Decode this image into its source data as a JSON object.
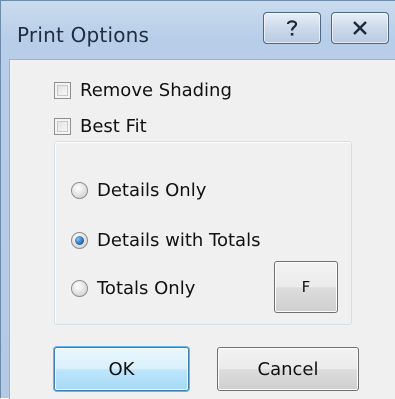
{
  "window": {
    "title": "Print Options",
    "help_label": "?",
    "close_icon": "close-icon"
  },
  "options": {
    "remove_shading": {
      "label": "Remove Shading",
      "checked": false
    },
    "best_fit": {
      "label": "Best Fit",
      "checked": false
    }
  },
  "detail_mode": {
    "selected": "Details with Totals",
    "choices": [
      {
        "label": "Details Only",
        "checked": false
      },
      {
        "label": "Details with Totals",
        "checked": true
      },
      {
        "label": "Totals Only",
        "checked": false
      }
    ]
  },
  "buttons": {
    "font": "F",
    "ok": "OK",
    "cancel": "Cancel"
  }
}
